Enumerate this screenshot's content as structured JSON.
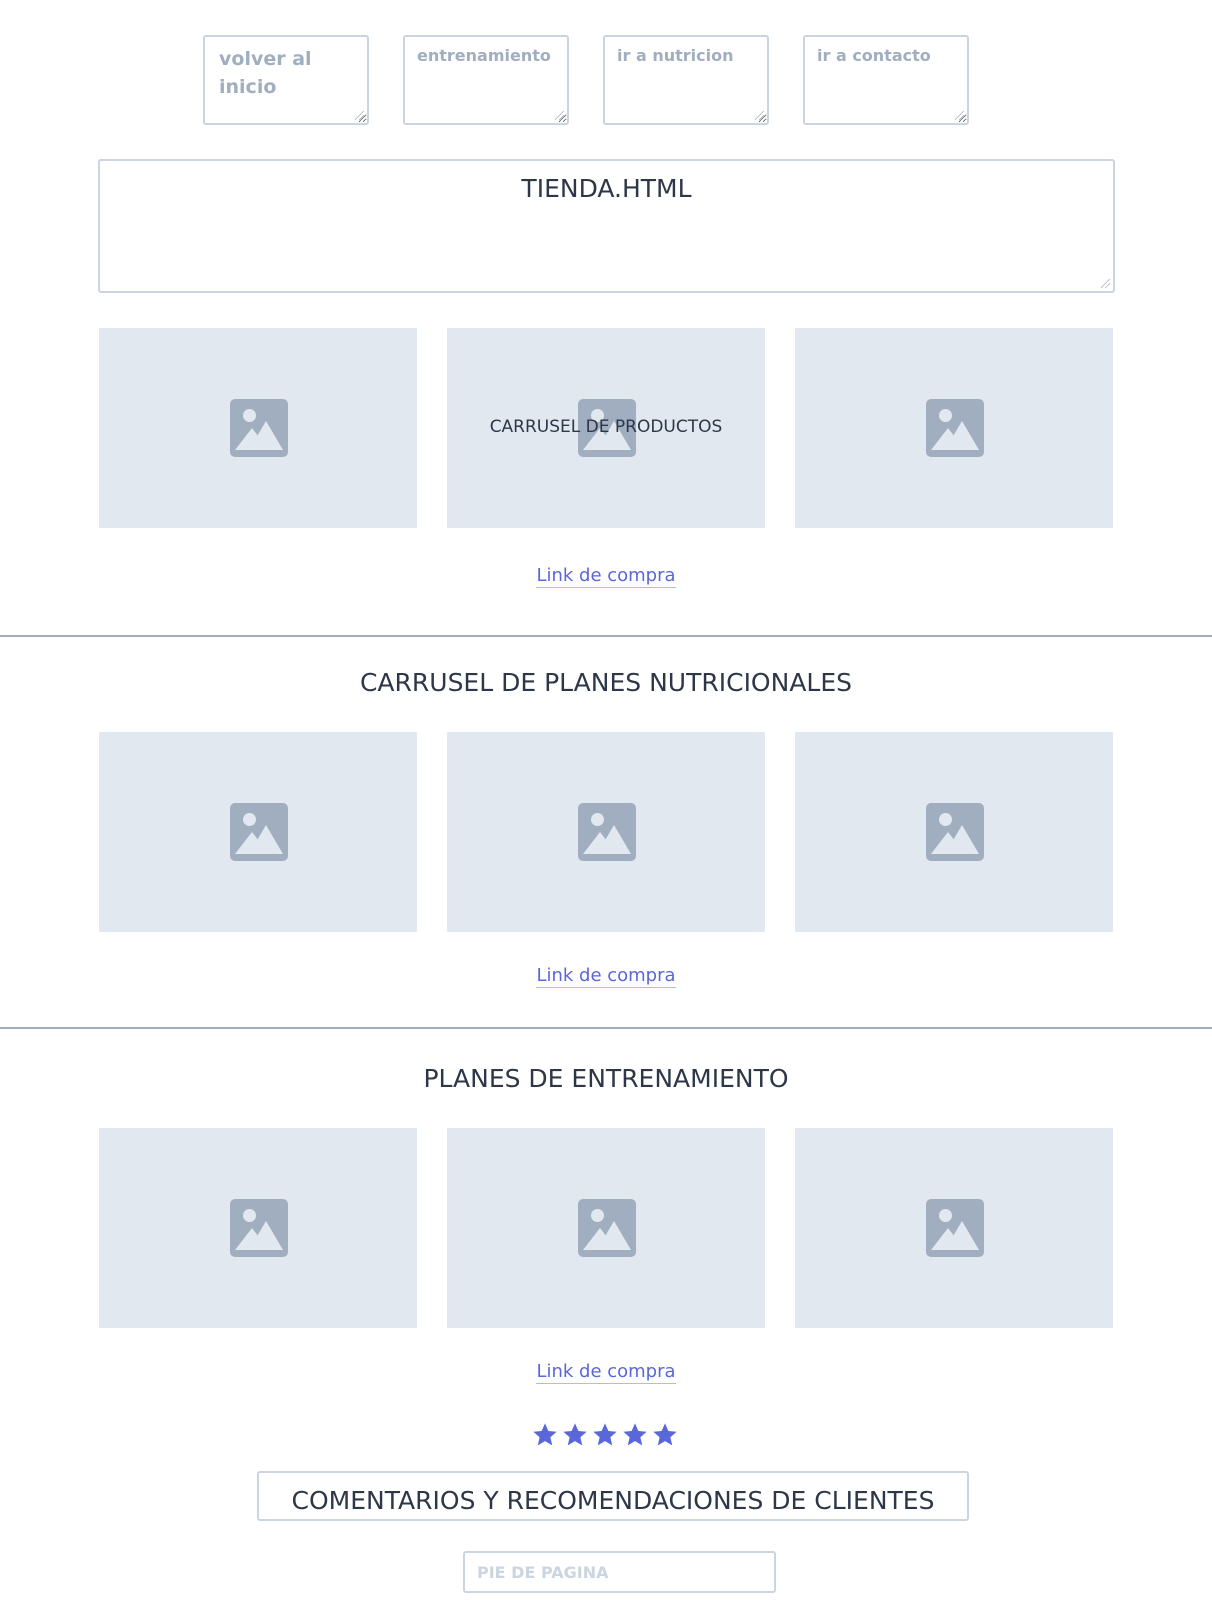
{
  "nav": {
    "items": [
      {
        "placeholder": "volver al\ninicio"
      },
      {
        "placeholder": "entrenamiento"
      },
      {
        "placeholder": "ir a nutricion"
      },
      {
        "placeholder": "ir a contacto"
      }
    ]
  },
  "page_title": "TIENDA.HTML",
  "sections": [
    {
      "title": "",
      "overlay_label": "CARRUSEL DE PRODUCTOS",
      "link": "Link de compra"
    },
    {
      "title": "CARRUSEL DE PLANES NUTRICIONALES",
      "link": "Link de compra"
    },
    {
      "title": "PLANES DE ENTRENAMIENTO",
      "link": "Link de compra"
    }
  ],
  "rating": {
    "stars": 5,
    "color": "#5a67d8"
  },
  "comments_title": "COMENTARIOS Y RECOMENDACIONES DE CLIENTES",
  "footer": {
    "placeholder": "PIE DE PAGINA"
  },
  "image_icon": "image-placeholder-icon"
}
